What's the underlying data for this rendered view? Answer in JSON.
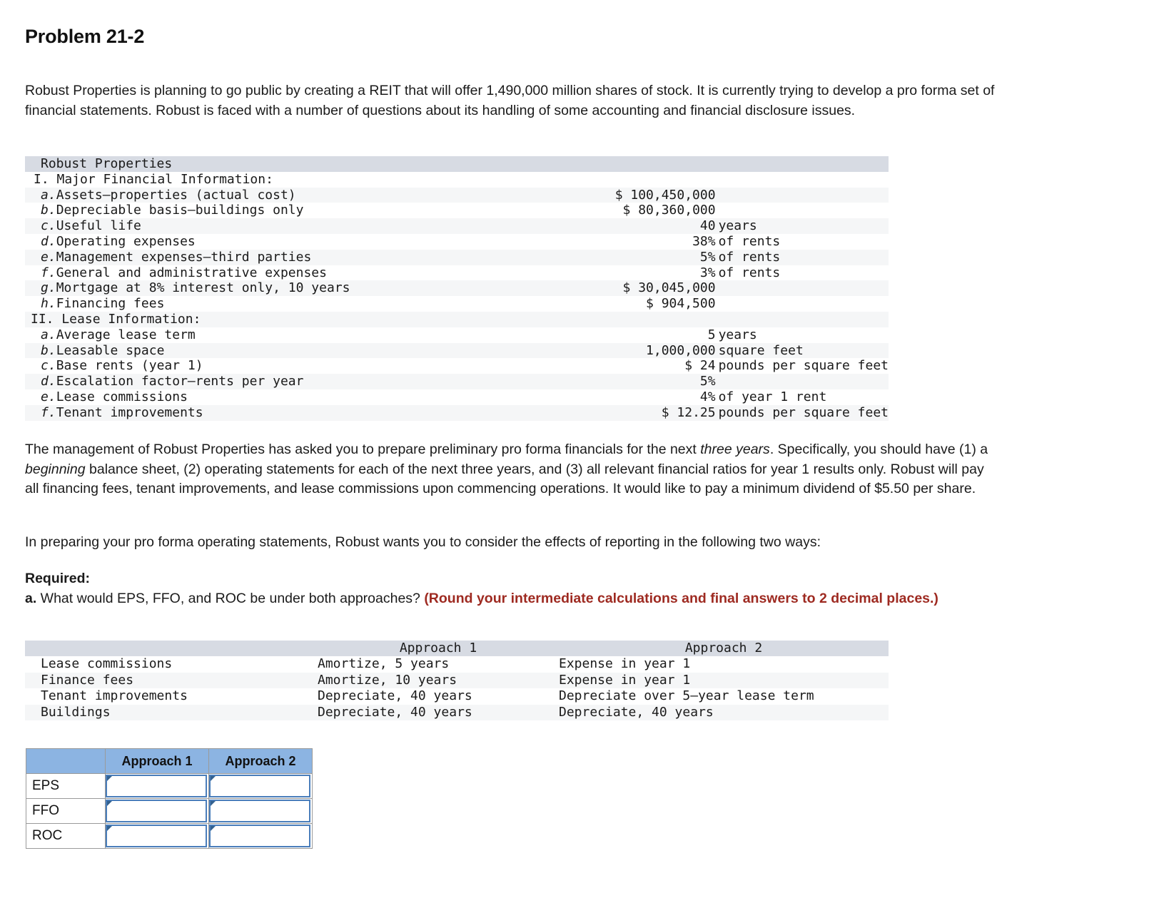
{
  "problem": {
    "title": "Problem 21-2",
    "intro": "Robust Properties is planning to go public by creating a REIT that will offer 1,490,000 million shares of stock. It is currently trying to develop a pro forma set of financial statements. Robust is faced with a number of questions about its handling of some accounting and financial disclosure issues.",
    "management_note_pre": "The management of Robust Properties has asked you to prepare preliminary pro forma financials for the next ",
    "management_note_em": "three years",
    "management_note_mid": ". Specifically, you should have (1) a ",
    "management_note_em2": "beginning",
    "management_note_post": " balance sheet, (2) operating statements for each of the next three years, and (3) all relevant financial ratios for year 1 results only. Robust will pay all financing fees, tenant improvements, and lease commissions upon commencing operations. It would like to pay a minimum dividend of $5.50 per share.",
    "preparing_note": "In preparing your pro forma operating statements, Robust wants you to consider the effects of reporting in the following two ways:",
    "required_label": "Required:",
    "required_a_prefix": "a.",
    "required_a_text": " What would EPS, FFO, and ROC be under both approaches? ",
    "required_a_red": "(Round your intermediate calculations and final answers to 2 decimal places.)"
  },
  "info_table": {
    "header": "Robust Properties",
    "sections": [
      {
        "heading": "I. Major Financial Information:"
      },
      {
        "letter": "a.",
        "label": "Assets—properties (actual cost)",
        "number": "$ 100,450,000",
        "unit": ""
      },
      {
        "letter": "b.",
        "label": "Depreciable basis—buildings only",
        "number": "$ 80,360,000",
        "unit": ""
      },
      {
        "letter": "c.",
        "label": "Useful life",
        "number": "40",
        "unit": "years"
      },
      {
        "letter": "d.",
        "label": "Operating expenses",
        "number": "38%",
        "unit": "of rents"
      },
      {
        "letter": "e.",
        "label": "Management expenses—third parties",
        "number": "5%",
        "unit": "of rents"
      },
      {
        "letter": "f.",
        "label": "General and administrative expenses",
        "number": "3%",
        "unit": "of rents"
      },
      {
        "letter": "g.",
        "label": "Mortgage at 8% interest only, 10 years",
        "number": "$ 30,045,000",
        "unit": ""
      },
      {
        "letter": "h.",
        "label": "Financing fees",
        "number": "$ 904,500",
        "unit": ""
      },
      {
        "heading": "II. Lease Information:"
      },
      {
        "letter": "a.",
        "label": "Average lease term",
        "number": "5",
        "unit": "years"
      },
      {
        "letter": "b.",
        "label": "Leasable space",
        "number": "1,000,000",
        "unit": "square feet"
      },
      {
        "letter": "c.",
        "label": "Base rents (year 1)",
        "number": "$ 24",
        "unit": "pounds per square feet"
      },
      {
        "letter": "d.",
        "label": "Escalation factor—rents per year",
        "number": "5%",
        "unit": ""
      },
      {
        "letter": "e.",
        "label": "Lease commissions",
        "number": "4%",
        "unit": "of year 1 rent"
      },
      {
        "letter": "f.",
        "label": "Tenant improvements",
        "number": "$ 12.25",
        "unit": "pounds per square feet"
      }
    ]
  },
  "approach_table": {
    "columns": [
      "",
      "Approach 1",
      "Approach 2"
    ],
    "rows": [
      {
        "item": "Lease commissions",
        "approach1": "Amortize, 5 years",
        "approach2": "Expense in year 1"
      },
      {
        "item": "Finance fees",
        "approach1": "Amortize, 10 years",
        "approach2": "Expense in year 1"
      },
      {
        "item": "Tenant improvements",
        "approach1": "Depreciate, 40 years",
        "approach2": "Depreciate over 5—year lease term"
      },
      {
        "item": "Buildings",
        "approach1": "Depreciate, 40 years",
        "approach2": "Depreciate, 40 years"
      }
    ]
  },
  "answer_grid": {
    "columns": [
      "Approach 1",
      "Approach 2"
    ],
    "rows": [
      {
        "label": "EPS",
        "approach1": "",
        "approach2": ""
      },
      {
        "label": "FFO",
        "approach1": "",
        "approach2": ""
      },
      {
        "label": "ROC",
        "approach1": "",
        "approach2": ""
      }
    ]
  },
  "colors": {
    "table_header_band": "#d7dbe3",
    "row_stripe": "#f5f6f7",
    "grid_header_blue": "#8cb4e2",
    "input_border_blue": "#4a7ebb",
    "emphasis_red": "#9e2a21"
  }
}
